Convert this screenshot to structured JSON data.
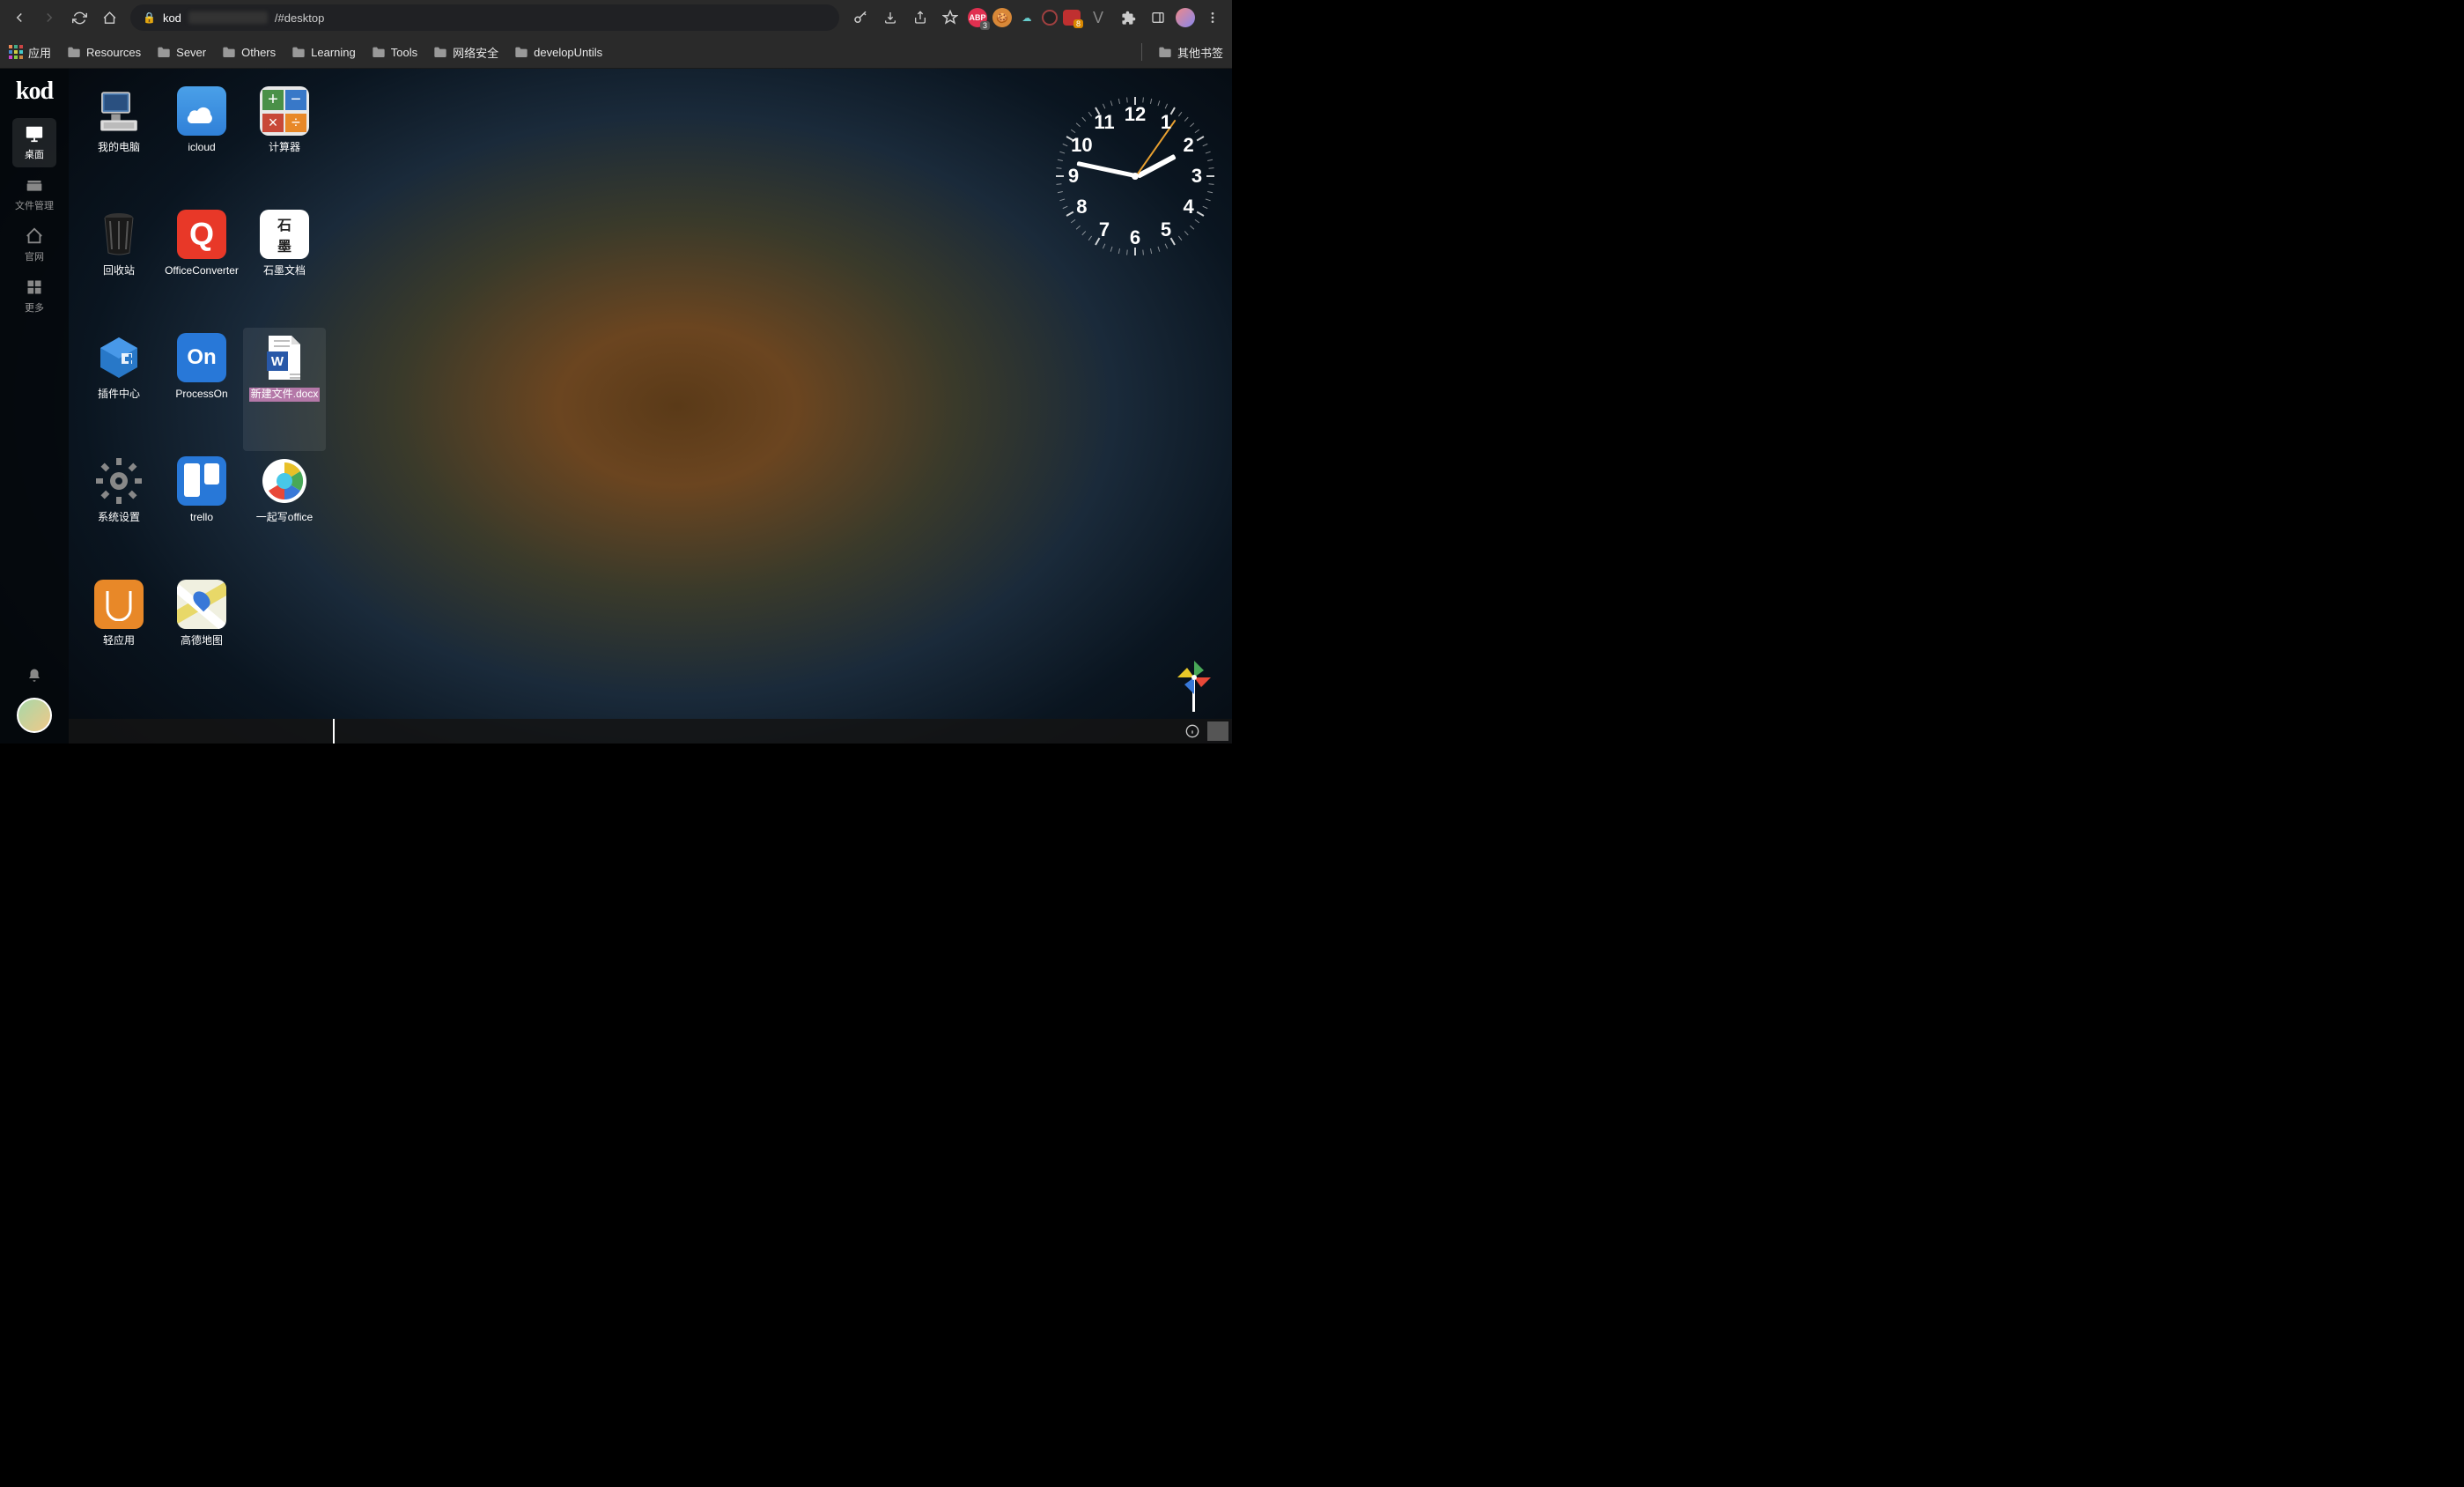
{
  "browser": {
    "url_host": "kod",
    "url_path": "/#desktop",
    "bookmarks": [
      "应用",
      "Resources",
      "Sever",
      "Others",
      "Learning",
      "Tools",
      "网络安全",
      "developUntils"
    ],
    "other_bookmarks": "其他书签",
    "ext_badges": {
      "abp": "3",
      "box": "8"
    }
  },
  "sidebar": {
    "logo": "kod",
    "items": [
      {
        "label": "桌面",
        "icon": "monitor",
        "active": true
      },
      {
        "label": "文件管理",
        "icon": "folder"
      },
      {
        "label": "官网",
        "icon": "home"
      },
      {
        "label": "更多",
        "icon": "grid"
      }
    ]
  },
  "desktop_icons": [
    {
      "label": "我的电脑",
      "type": "pc"
    },
    {
      "label": "icloud",
      "type": "cloud"
    },
    {
      "label": "计算器",
      "type": "calc"
    },
    {
      "label": "回收站",
      "type": "trash"
    },
    {
      "label": "OfficeConverter",
      "type": "office-conv"
    },
    {
      "label": "石墨文档",
      "type": "shimo"
    },
    {
      "label": "插件中心",
      "type": "plugin"
    },
    {
      "label": "ProcessOn",
      "type": "processon"
    },
    {
      "label": "新建文件.docx",
      "type": "docx",
      "selected": true
    },
    {
      "label": "系统设置",
      "type": "gear"
    },
    {
      "label": "trello",
      "type": "trello"
    },
    {
      "label": "一起写office",
      "type": "yiqixie"
    },
    {
      "label": "轻应用",
      "type": "lightapp"
    },
    {
      "label": "高德地图",
      "type": "amap"
    }
  ],
  "clock": {
    "hour_angle": 62,
    "minute_angle": 282,
    "second_angle": 35,
    "numbers": [
      "12",
      "1",
      "2",
      "3",
      "4",
      "5",
      "6",
      "7",
      "8",
      "9",
      "10",
      "11"
    ]
  }
}
